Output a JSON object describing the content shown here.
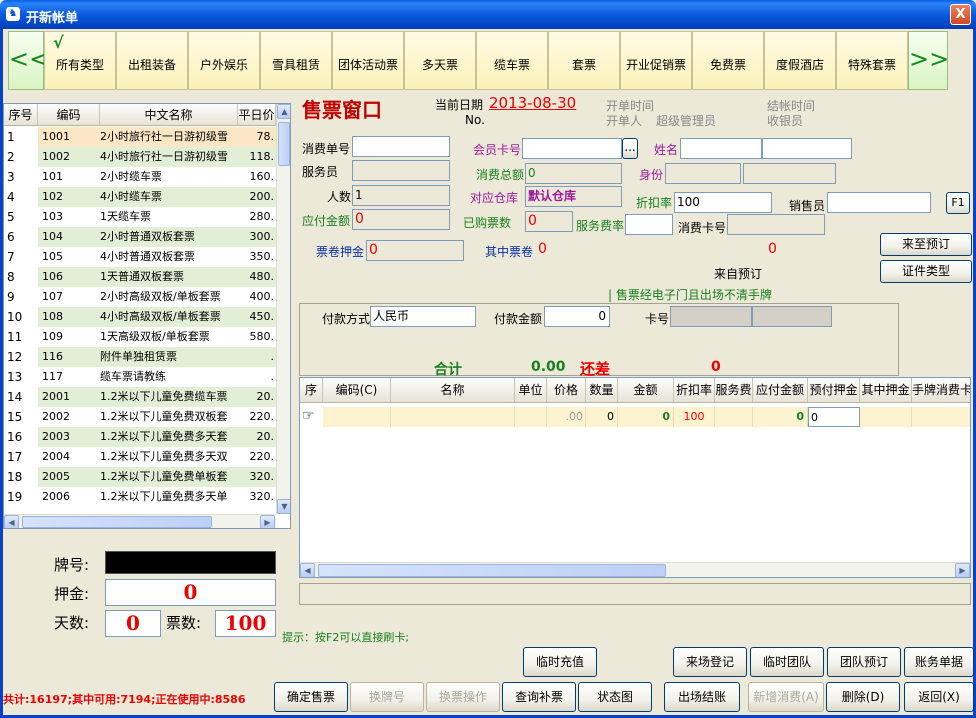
{
  "window": {
    "title": "开新帐单",
    "close_label": "X"
  },
  "categories": {
    "nav_left": "<<",
    "nav_right": ">>",
    "selected_mark": "√",
    "items": [
      "所有类型",
      "出租装备",
      "户外娱乐",
      "雪具租赁",
      "团体活动票",
      "多天票",
      "缆车票",
      "套票",
      "开业促销票",
      "免费票",
      "度假酒店",
      "特殊套票"
    ]
  },
  "product_table": {
    "columns": [
      "序号",
      "编码",
      "中文名称",
      "平日价"
    ],
    "rows": [
      [
        "1",
        "1001",
        "2小时旅行社一日游初级雪",
        "78."
      ],
      [
        "2",
        "1002",
        "4小时旅行社一日游初级雪",
        "118."
      ],
      [
        "3",
        "101",
        "2小时缆车票",
        "160."
      ],
      [
        "4",
        "102",
        "4小时缆车票",
        "200."
      ],
      [
        "5",
        "103",
        "1天缆车票",
        "280."
      ],
      [
        "6",
        "104",
        "2小时普通双板套票",
        "300."
      ],
      [
        "7",
        "105",
        "4小时普通双板套票",
        "350."
      ],
      [
        "8",
        "106",
        "1天普通双板套票",
        "480."
      ],
      [
        "9",
        "107",
        "2小时高级双板/单板套票",
        "400."
      ],
      [
        "10",
        "108",
        "4小时高级双板/单板套票",
        "450."
      ],
      [
        "11",
        "109",
        "1天高级双板/单板套票",
        "580."
      ],
      [
        "12",
        "116",
        "附件单独租赁票",
        "."
      ],
      [
        "13",
        "117",
        "缆车票请教练",
        "."
      ],
      [
        "14",
        "2001",
        "1.2米以下儿童免费缆车票",
        "20."
      ],
      [
        "15",
        "2002",
        "1.2米以下儿童免费双板套",
        "220."
      ],
      [
        "16",
        "2003",
        "1.2米以下儿童免费多天套",
        "20."
      ],
      [
        "17",
        "2004",
        "1.2米以下儿童免费多天双",
        "220."
      ],
      [
        "18",
        "2005",
        "1.2米以下儿童免费单板套",
        "320."
      ],
      [
        "19",
        "2006",
        "1.2米以下儿童免费多天单",
        "320."
      ]
    ]
  },
  "card_panel": {
    "tag_label": "牌号:",
    "deposit_label": "押金:",
    "deposit_value": "0",
    "days_label": "天数:",
    "days_value": "0",
    "tickets_label": "票数:",
    "tickets_value": "100"
  },
  "ticket_window": {
    "heading": "售票窗口",
    "current_date_label": "当前日期",
    "current_date": "2013-08-30",
    "no_label": "No.",
    "open_time_label": "开单时间",
    "opener_label": "开单人",
    "opener_value": "超级管理员",
    "close_time_label": "结帐时间",
    "cashier_label": "收银员"
  },
  "form": {
    "consume_no_label": "消费单号",
    "member_card_label": "会员卡号",
    "browse_label": "...",
    "name_label": "姓名",
    "waiter_label": "服务员",
    "total_consume_label": "消费总额",
    "total_consume_value": "0",
    "id_label": "身份",
    "people_label": "人数",
    "people_value": "1",
    "warehouse_label": "对应仓库",
    "warehouse_value": "默认仓库",
    "discount_label": "折扣率",
    "discount_value": "100",
    "salesperson_label": "销售员",
    "f1_label": "F1",
    "payable_label": "应付金额",
    "payable_value": "0",
    "bought_tickets_label": "已购票数",
    "bought_tickets_value": "0",
    "service_rate_label": "服务费率",
    "consume_card_label": "消费卡号",
    "voucher_deposit_label": "票卷押金",
    "voucher_deposit_value": "0",
    "among_vouchers_label": "其中票卷",
    "among_vouchers_value": "0",
    "reserve_value": "0",
    "from_reserve_label": "来自预订",
    "not_reserved_button": "来至预订",
    "id_type_button": "证件类型",
    "notice": "| 售票经电子门且出场不清手牌"
  },
  "payment": {
    "method_label": "付款方式",
    "method_value": "人民币",
    "amount_label": "付款金额",
    "amount_value": "0",
    "card_no_label": "卡号",
    "total_label": "合计",
    "total_value": "0.00",
    "balance_label": "还差",
    "balance_value": "0"
  },
  "detail_table": {
    "columns": [
      "序",
      "编码(C)",
      "名称",
      "单位",
      "价格",
      "数量",
      "金额",
      "折扣率",
      "服务费",
      "应付金额",
      "预付押金",
      "其中押金",
      "手牌消费卡"
    ],
    "row": {
      "price": ".00",
      "qty": "0",
      "amount": "0",
      "discount": "100",
      "payable": "0",
      "prepaid_deposit": "0"
    }
  },
  "hint": "提示：按F2可以直接刷卡;",
  "status_line": "共计:16197;其中可用:7194;正在使用中:8586",
  "buttons": {
    "top_row": [
      "临时充值",
      "来场登记",
      "临时团队",
      "团队预订",
      "账务单据"
    ],
    "bottom_row": [
      "确定售票",
      "换牌号",
      "换票操作",
      "查询补票",
      "状态图",
      "出场结账",
      "新增消费(A)",
      "删除(D)",
      "返回(X)"
    ]
  }
}
